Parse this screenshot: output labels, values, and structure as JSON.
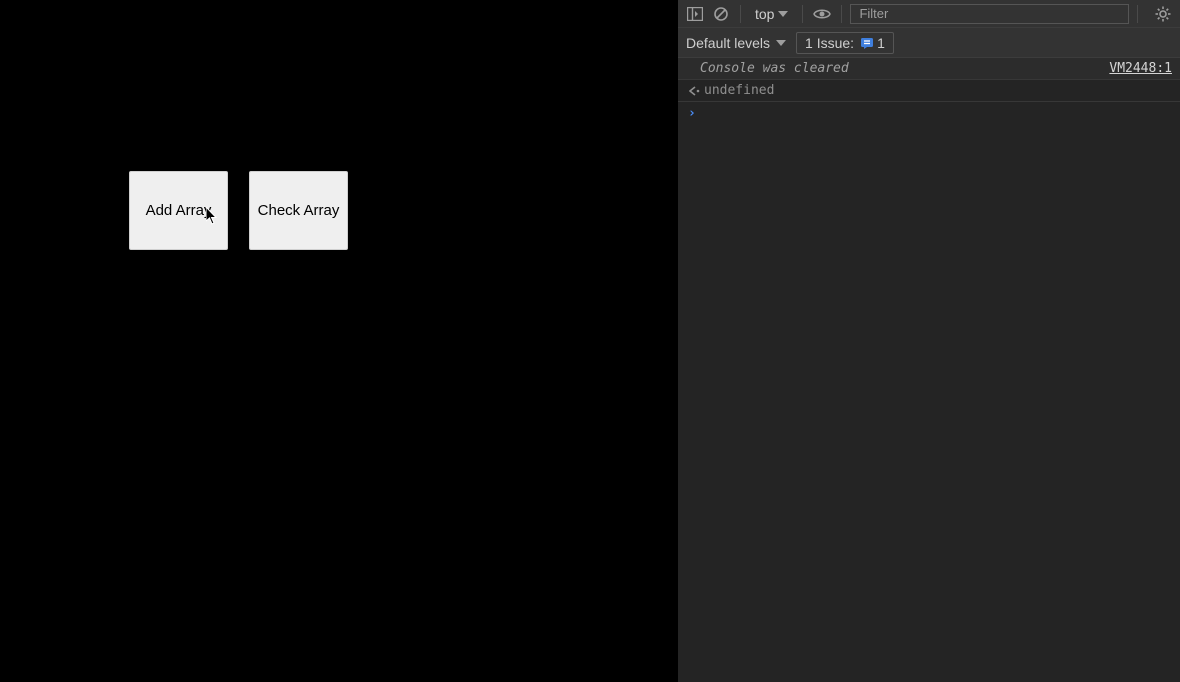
{
  "page": {
    "buttons": {
      "add_label": "Add Array",
      "check_label": "Check Array"
    }
  },
  "devtools": {
    "toolbar1": {
      "context_label": "top",
      "filter_placeholder": "Filter"
    },
    "toolbar2": {
      "levels_label": "Default levels",
      "issues_label": "1 Issue:",
      "issues_count": "1"
    },
    "messages": {
      "cleared_text": "Console was cleared",
      "cleared_source": "VM2448:1",
      "return_value": "undefined"
    },
    "prompt": {
      "chevron": "›"
    }
  }
}
